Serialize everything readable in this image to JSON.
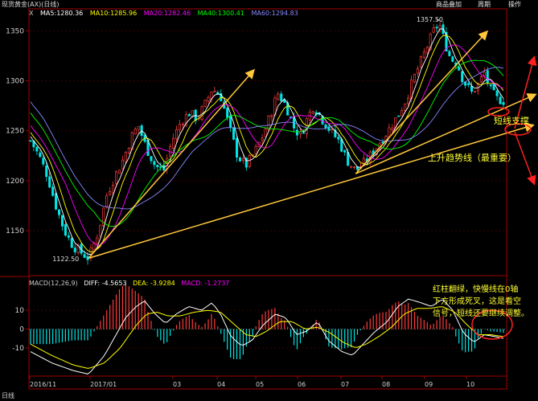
{
  "window": {
    "title": "现货黄金(AX)(日线)",
    "buttons": [
      "商品叠加",
      "周期",
      "操作"
    ],
    "period_label": "日线"
  },
  "legend": {
    "indicator": "X",
    "ma": [
      {
        "label": "MA5:1280.36",
        "color": "#ffffff"
      },
      {
        "label": "MA10:1285.96",
        "color": "#ffff00"
      },
      {
        "label": "MA20:1282.46",
        "color": "#ff00ff"
      },
      {
        "label": "MA40:1300.41",
        "color": "#00ff00"
      },
      {
        "label": "MA60:1294.83",
        "color": "#8888ff"
      }
    ],
    "macd": [
      {
        "label": "MACD(12,26,9)",
        "color": "#c8c8c8"
      },
      {
        "label": "DIFF: -4.5653",
        "color": "#ffffff"
      },
      {
        "label": "DEA: -3.9284",
        "color": "#ffff00"
      },
      {
        "label": "MACD: -1.2737",
        "color": "#ff00ff"
      }
    ]
  },
  "annotations": {
    "low_label": "1122.50",
    "high_label": "1357.50",
    "short_support": "短线支撑",
    "uptrend": "上升趋势线（最重要）",
    "macd_note": [
      "红柱翻绿，快慢线在0轴",
      "下方形成死叉，这是看空",
      "信号，短线还要继续调整。"
    ]
  },
  "chart_data": {
    "type": "candlestick",
    "title": "",
    "xlabel": "",
    "ylabel": "",
    "ylim": [
      1105,
      1372
    ],
    "y_ticks": [
      1150,
      1200,
      1250,
      1300,
      1350
    ],
    "x_ticks": [
      "2016/11",
      "2017/01",
      "03",
      "04",
      "05",
      "06",
      "07",
      "08",
      "09",
      "10"
    ],
    "price_points": [
      [
        0,
        1240
      ],
      [
        8,
        1225
      ],
      [
        16,
        1205
      ],
      [
        24,
        1175
      ],
      [
        32,
        1150
      ],
      [
        40,
        1135
      ],
      [
        48,
        1128
      ],
      [
        55,
        1122.5
      ],
      [
        64,
        1148
      ],
      [
        72,
        1185
      ],
      [
        80,
        1205
      ],
      [
        88,
        1222
      ],
      [
        96,
        1245
      ],
      [
        102,
        1255
      ],
      [
        110,
        1232
      ],
      [
        118,
        1215
      ],
      [
        126,
        1210
      ],
      [
        134,
        1240
      ],
      [
        142,
        1258
      ],
      [
        150,
        1268
      ],
      [
        158,
        1262
      ],
      [
        166,
        1278
      ],
      [
        172,
        1292
      ],
      [
        180,
        1285
      ],
      [
        188,
        1255
      ],
      [
        196,
        1225
      ],
      [
        204,
        1215
      ],
      [
        212,
        1228
      ],
      [
        220,
        1245
      ],
      [
        228,
        1268
      ],
      [
        234,
        1288
      ],
      [
        242,
        1275
      ],
      [
        250,
        1252
      ],
      [
        256,
        1245
      ],
      [
        262,
        1262
      ],
      [
        268,
        1275
      ],
      [
        276,
        1262
      ],
      [
        284,
        1250
      ],
      [
        292,
        1240
      ],
      [
        300,
        1220
      ],
      [
        308,
        1210
      ],
      [
        316,
        1218
      ],
      [
        324,
        1228
      ],
      [
        332,
        1240
      ],
      [
        340,
        1252
      ],
      [
        348,
        1265
      ],
      [
        356,
        1282
      ],
      [
        362,
        1300
      ],
      [
        370,
        1320
      ],
      [
        376,
        1335
      ],
      [
        382,
        1350
      ],
      [
        387,
        1357.5
      ],
      [
        392,
        1340
      ],
      [
        398,
        1322
      ],
      [
        404,
        1318
      ],
      [
        410,
        1300
      ],
      [
        418,
        1288
      ],
      [
        424,
        1296
      ],
      [
        430,
        1308
      ],
      [
        436,
        1290
      ],
      [
        442,
        1282
      ],
      [
        448,
        1280
      ]
    ],
    "ma_series": [
      {
        "name": "MA5",
        "color": "#ffffff",
        "smooth": 3
      },
      {
        "name": "MA10",
        "color": "#ffff00",
        "smooth": 6
      },
      {
        "name": "MA20",
        "color": "#ff00ff",
        "smooth": 11
      },
      {
        "name": "MA40",
        "color": "#00ff00",
        "smooth": 20
      },
      {
        "name": "MA60",
        "color": "#8888ff",
        "smooth": 28
      }
    ],
    "macd": {
      "ylim": [
        -25,
        25
      ],
      "y_ticks": [
        10,
        0,
        -10
      ],
      "diff": [
        [
          0,
          -12
        ],
        [
          20,
          -18
        ],
        [
          40,
          -22
        ],
        [
          55,
          -24
        ],
        [
          70,
          -14
        ],
        [
          80,
          -4
        ],
        [
          90,
          6
        ],
        [
          100,
          12
        ],
        [
          108,
          15
        ],
        [
          118,
          8
        ],
        [
          128,
          3
        ],
        [
          138,
          8
        ],
        [
          150,
          12
        ],
        [
          162,
          10
        ],
        [
          172,
          14
        ],
        [
          180,
          8
        ],
        [
          190,
          -4
        ],
        [
          200,
          -9
        ],
        [
          210,
          -6
        ],
        [
          220,
          2
        ],
        [
          232,
          8
        ],
        [
          242,
          6
        ],
        [
          252,
          -3
        ],
        [
          262,
          -1
        ],
        [
          272,
          4
        ],
        [
          282,
          -6
        ],
        [
          295,
          -12
        ],
        [
          305,
          -14
        ],
        [
          315,
          -8
        ],
        [
          325,
          -2
        ],
        [
          338,
          4
        ],
        [
          348,
          12
        ],
        [
          358,
          16
        ],
        [
          370,
          14
        ],
        [
          380,
          12
        ],
        [
          390,
          16
        ],
        [
          400,
          10
        ],
        [
          410,
          -2
        ],
        [
          420,
          -7
        ],
        [
          430,
          -3
        ],
        [
          440,
          -4
        ],
        [
          448,
          -5
        ]
      ],
      "dea": [
        [
          0,
          -8
        ],
        [
          20,
          -14
        ],
        [
          40,
          -19
        ],
        [
          55,
          -21
        ],
        [
          70,
          -18
        ],
        [
          85,
          -10
        ],
        [
          100,
          2
        ],
        [
          110,
          8
        ],
        [
          120,
          9
        ],
        [
          130,
          7
        ],
        [
          142,
          7
        ],
        [
          155,
          9
        ],
        [
          168,
          10
        ],
        [
          180,
          9
        ],
        [
          192,
          3
        ],
        [
          204,
          -3
        ],
        [
          214,
          -4
        ],
        [
          224,
          -1
        ],
        [
          236,
          4
        ],
        [
          248,
          4
        ],
        [
          260,
          0
        ],
        [
          272,
          1
        ],
        [
          284,
          -2
        ],
        [
          296,
          -7
        ],
        [
          308,
          -10
        ],
        [
          318,
          -8
        ],
        [
          330,
          -4
        ],
        [
          342,
          1
        ],
        [
          354,
          8
        ],
        [
          366,
          11
        ],
        [
          378,
          11
        ],
        [
          390,
          12
        ],
        [
          402,
          9
        ],
        [
          414,
          2
        ],
        [
          424,
          -3
        ],
        [
          436,
          -3
        ],
        [
          448,
          -4
        ]
      ]
    }
  }
}
